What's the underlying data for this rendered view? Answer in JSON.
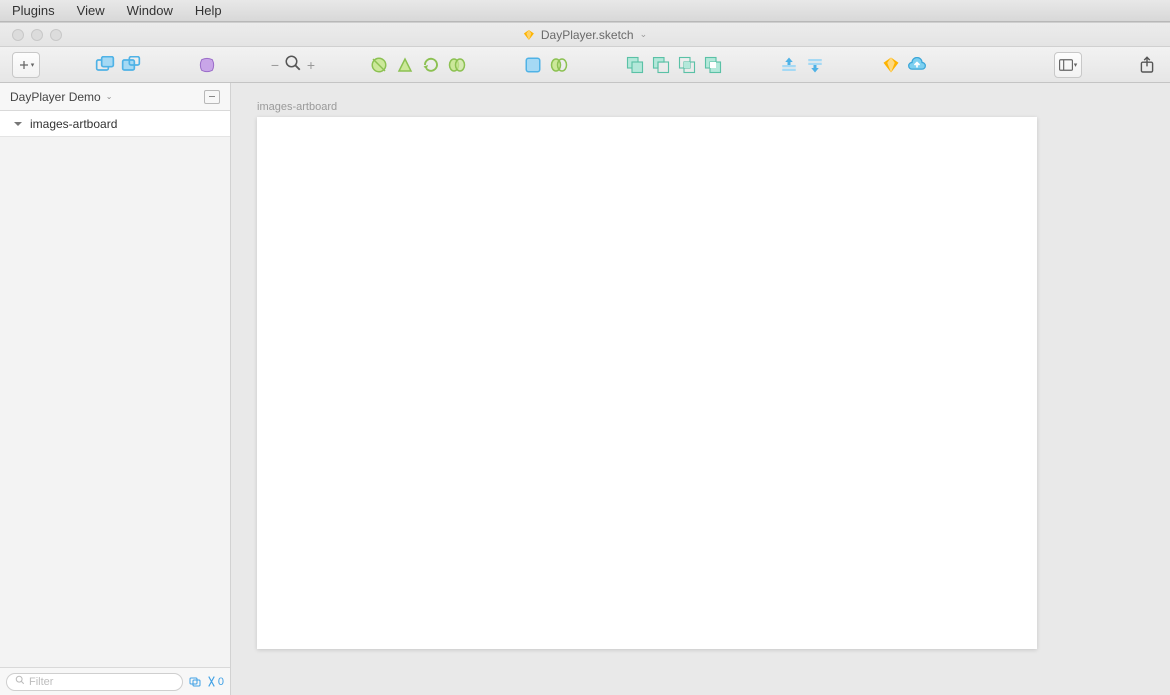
{
  "menubar": {
    "items": [
      "Plugins",
      "View",
      "Window",
      "Help"
    ]
  },
  "window": {
    "title": "DayPlayer.sketch"
  },
  "sidebar": {
    "page_name": "DayPlayer Demo",
    "layers": [
      {
        "name": "images-artboard"
      }
    ],
    "filter_placeholder": "Filter",
    "filter_count": "0"
  },
  "canvas": {
    "artboard_label": "images-artboard"
  }
}
